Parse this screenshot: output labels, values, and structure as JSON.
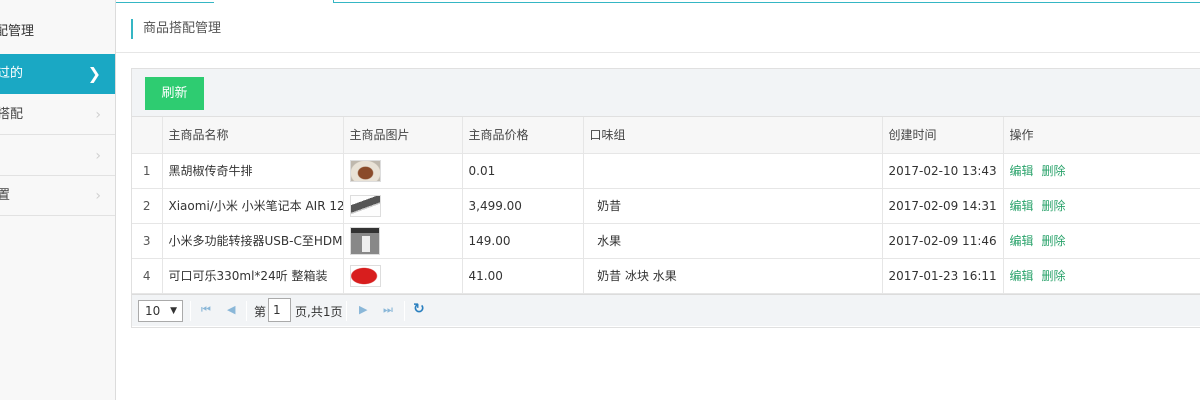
{
  "sidebar": {
    "title": "配管理",
    "items": [
      {
        "label": "过的",
        "active": true
      },
      {
        "label": "搭配",
        "active": false
      },
      {
        "label": "",
        "active": false
      },
      {
        "label": "置",
        "active": false
      }
    ]
  },
  "breadcrumb": {
    "title": "商品搭配管理"
  },
  "toolbar": {
    "refresh_label": "刷新"
  },
  "table": {
    "columns": [
      "主商品名称",
      "主商品图片",
      "主商品价格",
      "口味组",
      "创建时间",
      "操作"
    ],
    "rows": [
      {
        "index": "1",
        "name": "黑胡椒传奇牛排",
        "image_icon": "steak-thumbnail",
        "price": "0.01",
        "flavor": "",
        "created": "2017-02-10 13:43",
        "edit": "编辑",
        "delete": "删除"
      },
      {
        "index": "2",
        "name": "Xiaomi/小米 小米笔记本 AIR 12.",
        "image_icon": "laptop-thumbnail",
        "price": "3,499.00",
        "flavor": "奶昔",
        "created": "2017-02-09 14:31",
        "edit": "编辑",
        "delete": "删除"
      },
      {
        "index": "3",
        "name": "小米多功能转接器USB-C至HDM",
        "image_icon": "adapter-thumbnail",
        "price": "149.00",
        "flavor": "水果",
        "created": "2017-02-09 11:46",
        "edit": "编辑",
        "delete": "删除"
      },
      {
        "index": "4",
        "name": "可口可乐330ml*24听 整箱装",
        "image_icon": "cola-thumbnail",
        "price": "41.00",
        "flavor": "奶昔 冰块 水果",
        "created": "2017-01-23 16:11",
        "edit": "编辑",
        "delete": "删除"
      }
    ]
  },
  "pager": {
    "page_size": "10",
    "page_prefix": "第",
    "current_page": "1",
    "page_suffix": "页,共1页"
  },
  "colors": {
    "accent": "#1aa8c4",
    "refresh": "#2ecc71",
    "action_link": "#2aa36b"
  }
}
